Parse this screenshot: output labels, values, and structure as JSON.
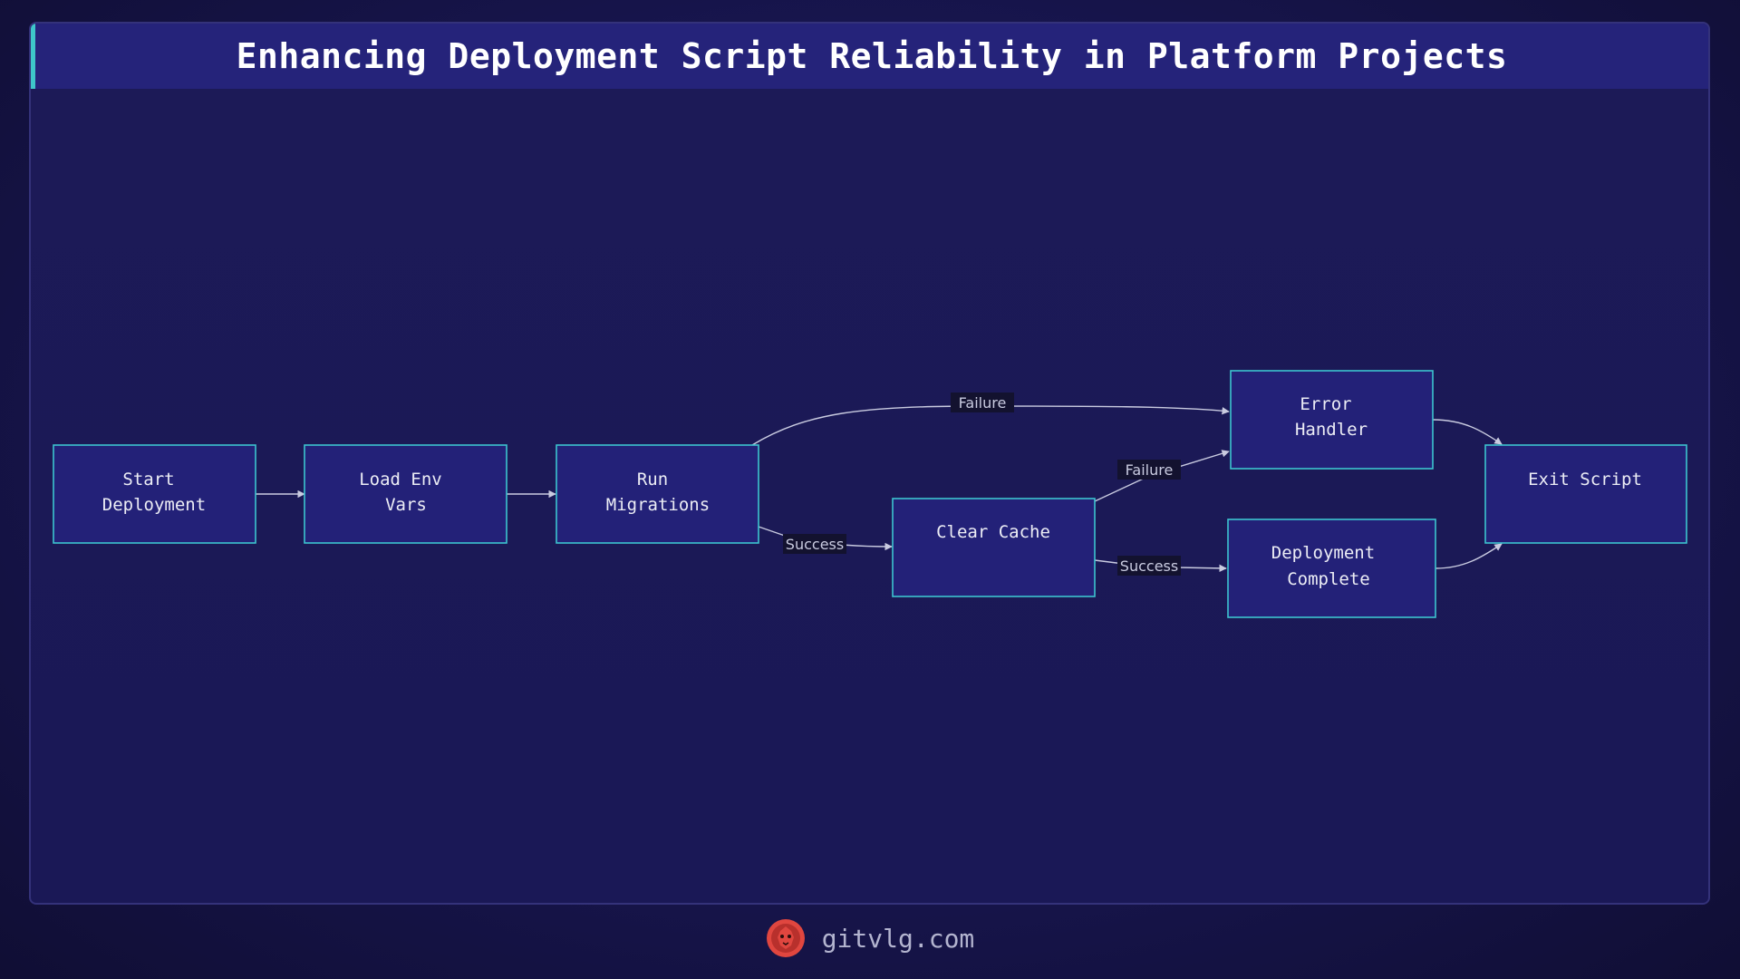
{
  "title": "Enhancing Deployment Script Reliability in Platform Projects",
  "nodes": {
    "start": [
      "Start",
      "Deployment"
    ],
    "load_env": [
      "Load Env",
      "Vars"
    ],
    "run_migrations": [
      "Run",
      "Migrations"
    ],
    "clear_cache": [
      "Clear Cache"
    ],
    "error_handler": [
      "Error",
      "Handler"
    ],
    "deployment_complete": [
      "Deployment",
      "Complete"
    ],
    "exit_script": [
      "Exit Script"
    ]
  },
  "edges": {
    "migrations_failure": "Failure",
    "migrations_success": "Success",
    "cache_failure": "Failure",
    "cache_success": "Success"
  },
  "footer": {
    "brand": "gitvlg.com",
    "logo_icon": "lion-logo-icon"
  },
  "colors": {
    "node_fill": "#232178",
    "node_border": "#3cc4cf",
    "title_accent": "#3ec6c9",
    "logo": "#e0463f"
  }
}
